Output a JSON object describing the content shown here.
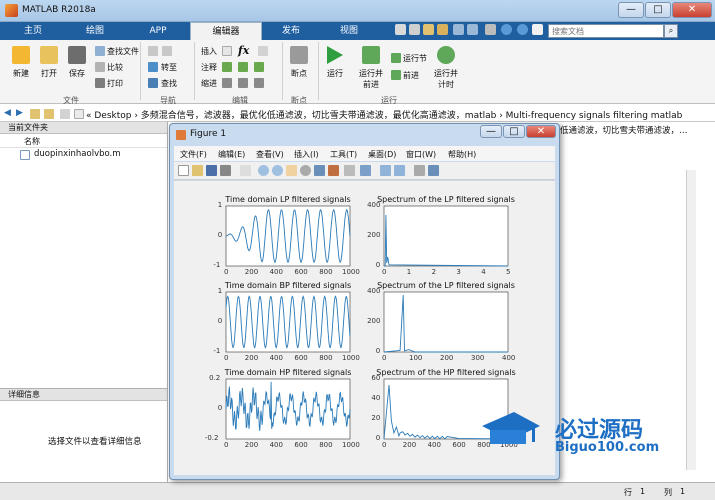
{
  "window": {
    "title": "MATLAB R2018a",
    "min": "—",
    "max": "□",
    "close": "✕"
  },
  "tabs": [
    {
      "label": "主页"
    },
    {
      "label": "绘图"
    },
    {
      "label": "APP"
    },
    {
      "label": "编辑器",
      "active": true
    },
    {
      "label": "发布"
    },
    {
      "label": "视图"
    }
  ],
  "search": {
    "placeholder": "搜索文档"
  },
  "ribbon": {
    "new": "新建",
    "open": "打开",
    "save": "保存",
    "find_files": "查找文件",
    "compare": "比较",
    "print": "打印",
    "goto": "转至",
    "find": "查找",
    "insert": "插入",
    "fx": "fx",
    "comment": "注释",
    "indent": "缩进",
    "breakpoints": "断点",
    "run": "运行",
    "run_advance": "运行并\n前进",
    "run_section": "运行节",
    "advance": "前进",
    "run_time": "运行并\n计时",
    "groups": {
      "file": "文件",
      "navigate": "导航",
      "edit": "编辑",
      "breakpoints": "断点",
      "run": "运行"
    }
  },
  "address": {
    "path": "« Desktop › 多频混合信号，滤波器，最优化低通滤波，切比雪夫带通滤波，最优化高通滤波，matlab › Multi-frequency signals filtering  matlab",
    "right_text": "低通滤波，切比雪夫带通滤波，…"
  },
  "current_folder": {
    "title": "当前文件夹",
    "col_name": "名称",
    "file": "duopinxinhaolvbo.m"
  },
  "details": {
    "title": "详细信息",
    "message": "选择文件以查看详细信息"
  },
  "status": {
    "row_label": "行",
    "row": "1",
    "col_label": "列",
    "col": "1"
  },
  "figure": {
    "title": "Figure 1",
    "menu": [
      "文件(F)",
      "编辑(E)",
      "查看(V)",
      "插入(I)",
      "工具(T)",
      "桌面(D)",
      "窗口(W)",
      "帮助(H)"
    ],
    "plots": [
      {
        "title": "Time domain LP filtered signals",
        "xticks": [
          "0",
          "200",
          "400",
          "600",
          "800",
          "1000"
        ],
        "yticks": [
          "1",
          "0",
          "-1"
        ]
      },
      {
        "title": "Spectrum of the LP filtered signals",
        "xticks": [
          "0",
          "1",
          "2",
          "3",
          "4",
          "5"
        ],
        "yticks": [
          "400",
          "200",
          "0"
        ]
      },
      {
        "title": "Time domain BP filtered signals",
        "xticks": [
          "0",
          "200",
          "400",
          "600",
          "800",
          "1000"
        ],
        "yticks": [
          "1",
          "0",
          "-1"
        ]
      },
      {
        "title": "Spectrum of the LP filtered signals",
        "xticks": [
          "0",
          "100",
          "200",
          "300",
          "400"
        ],
        "yticks": [
          "400",
          "200",
          "0"
        ]
      },
      {
        "title": "Time domain HP filtered signals",
        "xticks": [
          "0",
          "200",
          "400",
          "600",
          "800",
          "1000"
        ],
        "yticks": [
          "0.2",
          "0",
          "-0.2"
        ]
      },
      {
        "title": "Spectrum of the HP filtered signals",
        "xticks": [
          "0",
          "200",
          "400",
          "600",
          "800",
          "1000"
        ],
        "yticks": [
          "60",
          "40",
          "20",
          "0"
        ]
      }
    ]
  },
  "watermark": {
    "text": "必过源码",
    "url": "Biguo100.com"
  },
  "colors": {
    "line": "#2a7ab8",
    "tabbar": "#1f5fa0"
  }
}
